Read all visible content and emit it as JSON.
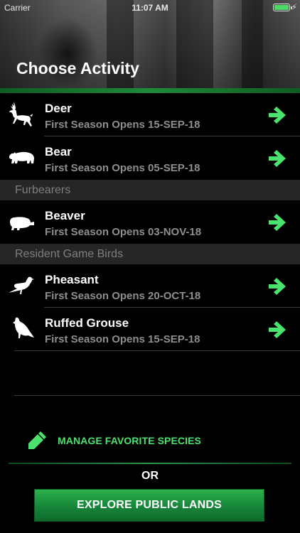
{
  "status_bar": {
    "carrier": "Carrier",
    "time": "11:07 AM"
  },
  "header": {
    "title": "Choose Activity"
  },
  "sections": [
    {
      "title": "",
      "items": [
        {
          "name": "Deer",
          "subtitle": "First Season Opens 15-SEP-18",
          "icon": "deer-icon"
        },
        {
          "name": "Bear",
          "subtitle": "First Season Opens 05-SEP-18",
          "icon": "bear-icon"
        }
      ]
    },
    {
      "title": "Furbearers",
      "items": [
        {
          "name": "Beaver",
          "subtitle": "First Season Opens 03-NOV-18",
          "icon": "beaver-icon"
        }
      ]
    },
    {
      "title": "Resident Game Birds",
      "items": [
        {
          "name": "Pheasant",
          "subtitle": "First Season Opens 20-OCT-18",
          "icon": "pheasant-icon"
        },
        {
          "name": "Ruffed Grouse",
          "subtitle": "First Season Opens 15-SEP-18",
          "icon": "grouse-icon"
        }
      ]
    }
  ],
  "footer": {
    "manage_label": "MANAGE FAVORITE SPECIES",
    "or_label": "OR",
    "explore_label": "EXPLORE PUBLIC LANDS"
  },
  "colors": {
    "accent_green": "#4be36e",
    "button_green": "#17853a",
    "section_bg": "#262626",
    "subtitle_gray": "#8e8e8e"
  }
}
